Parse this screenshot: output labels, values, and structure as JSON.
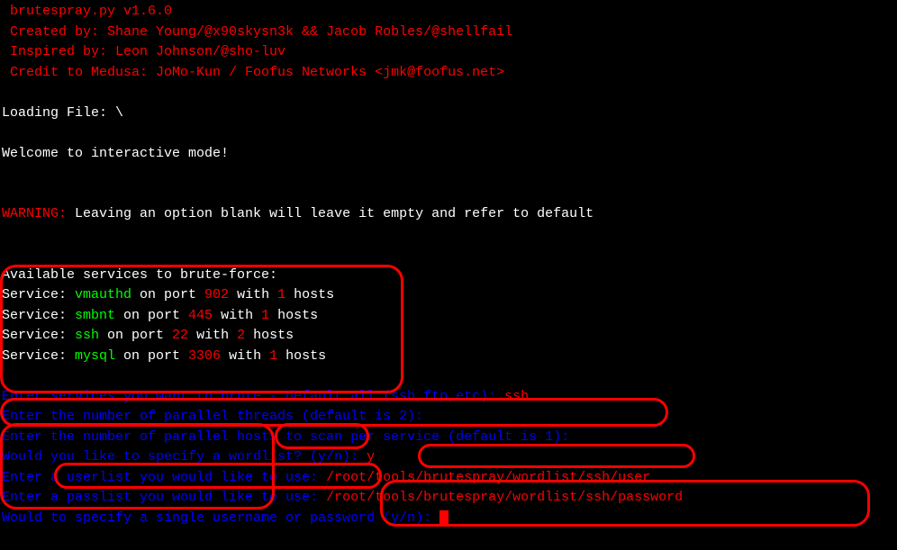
{
  "header": {
    "title": " brutespray.py v1.6.0",
    "created_by": " Created by: Shane Young/@x90skysn3k && Jacob Robles/@shellfail",
    "inspired_by": " Inspired by: Leon Johnson/@sho-luv",
    "credit": " Credit to Medusa: JoMo-Kun / Foofus Networks <jmk@foofus.net>"
  },
  "loading": "Loading File: \\",
  "welcome": "Welcome to interactive mode!",
  "warning_label": "WARNING:",
  "warning_text": " Leaving an option blank will leave it empty and refer to default",
  "services": {
    "header": "Available services to brute-force:",
    "prefix": "Service: ",
    "onport": " on port ",
    "with": " with ",
    "hosts": " hosts",
    "items": [
      {
        "name": "vmauthd",
        "port": "902",
        "count": "1"
      },
      {
        "name": "smbnt",
        "port": "445",
        "count": "1"
      },
      {
        "name": "ssh",
        "port": "22",
        "count": "2"
      },
      {
        "name": "mysql",
        "port": "3306",
        "count": "1"
      }
    ]
  },
  "prompts": {
    "p1_label": "Enter services you want to brute - default all (ssh,ftp,etc): ",
    "p1_value": "ssh",
    "p2": "Enter the number of parallel threads (default is 2):",
    "p3": "Enter the number of parallel hosts to scan per service (default is 1):",
    "p4_label": "Would you like to specify a wordlist? (y/n): ",
    "p4_value": "y",
    "p5_label": "Enter a userlist you would like to use: ",
    "p5_value": "/root/tools/brutespray/wordlist/ssh/user",
    "p6_label": "Enter a passlist you would like to use: ",
    "p6_value": "/root/tools/brutespray/wordlist/ssh/password",
    "p7": "Would to specify a single username or password (y/n): "
  }
}
